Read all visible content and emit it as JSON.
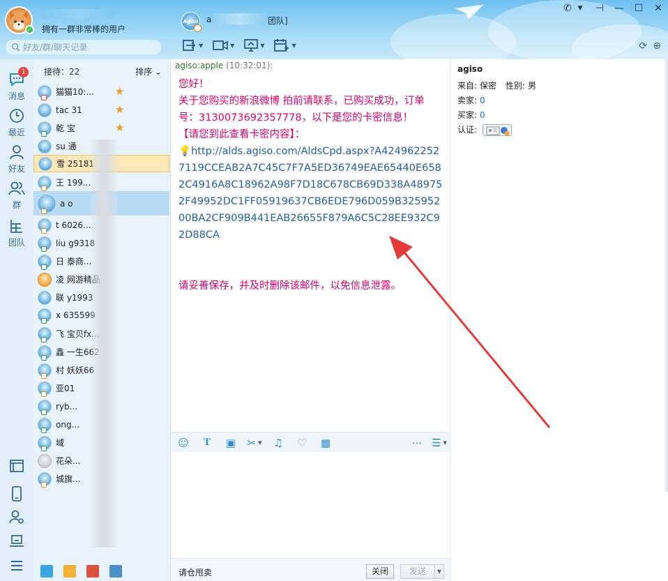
{
  "header": {
    "signature": "拥有一群非常棒的用户",
    "search_placeholder": "好友/群/聊天记录",
    "chat_title_prefix": "a",
    "chat_title_suffix": "团队]",
    "chat_avatar_text": "Agiso"
  },
  "nav": {
    "unread_badge": "1",
    "items": [
      {
        "label": "消息"
      },
      {
        "label": "最近"
      },
      {
        "label": "好友"
      },
      {
        "label": "群"
      },
      {
        "label": "团队"
      }
    ]
  },
  "contacts": {
    "receiving_label": "接待：22",
    "sort_label": "排序 ⌄",
    "items": [
      {
        "name": "猫猫10:..."
      },
      {
        "name": "tac     31"
      },
      {
        "name": "乾     宝"
      },
      {
        "name": "su     通"
      },
      {
        "name": "雪     25181"
      },
      {
        "name": "王     199..."
      },
      {
        "name": "a     o"
      },
      {
        "name": "t     6026..."
      },
      {
        "name": "liu     g9318"
      },
      {
        "name": "日     泰商..."
      },
      {
        "name": "凌     网游精品"
      },
      {
        "name": "联     y1993"
      },
      {
        "name": "x     635599"
      },
      {
        "name": "飞     宝贝fx..."
      },
      {
        "name": "鑫     一生662"
      },
      {
        "name": "村     妖妖66"
      },
      {
        "name": "     亚01"
      },
      {
        "name": "     ryb..."
      },
      {
        "name": "     ong..."
      },
      {
        "name": "     域"
      },
      {
        "name": "     花朵..."
      },
      {
        "name": "     城旗..."
      }
    ]
  },
  "chat": {
    "sender": "agiso:apple",
    "time": "(10:32:01):",
    "greeting": "您好！",
    "line1": "关于您购买的新浪微博 拍前请联系，已购买成功，订单号：3130073692357778，以下是您的卡密信息！",
    "line2": "【请您到此查看卡密内容】：",
    "link": "http://alds.agiso.com/AldsCpd.aspx?A4249622527119CCEAB2A7C45C7F7A5ED36749EAE65440E6582C4916A8C18962A98F7D18C678CB69D338A489752F49952DC1FF05919637CB6EDE796D059B32595200BA2CF909B441EAB26655F879A6C5C28EE932C92D88CA",
    "warning": "请妥善保存，并及时删除该邮件，以免信息泄露。",
    "quick_reply": "请仓甩卖",
    "close_label": "关闭",
    "send_label": "发送"
  },
  "info": {
    "username": "agiso",
    "from_label": "来自:",
    "from_value": "保密",
    "gender_label": "性别:",
    "gender_value": "男",
    "seller_label": "卖家:",
    "seller_value": "0",
    "buyer_label": "买家:",
    "buyer_value": "0",
    "cert_label": "认证:"
  },
  "colors": {
    "message_pink": "#e6006c",
    "link_blue": "#1f5ea8",
    "arrow_red": "#e53a3a",
    "badge_red": "#e9443c"
  }
}
